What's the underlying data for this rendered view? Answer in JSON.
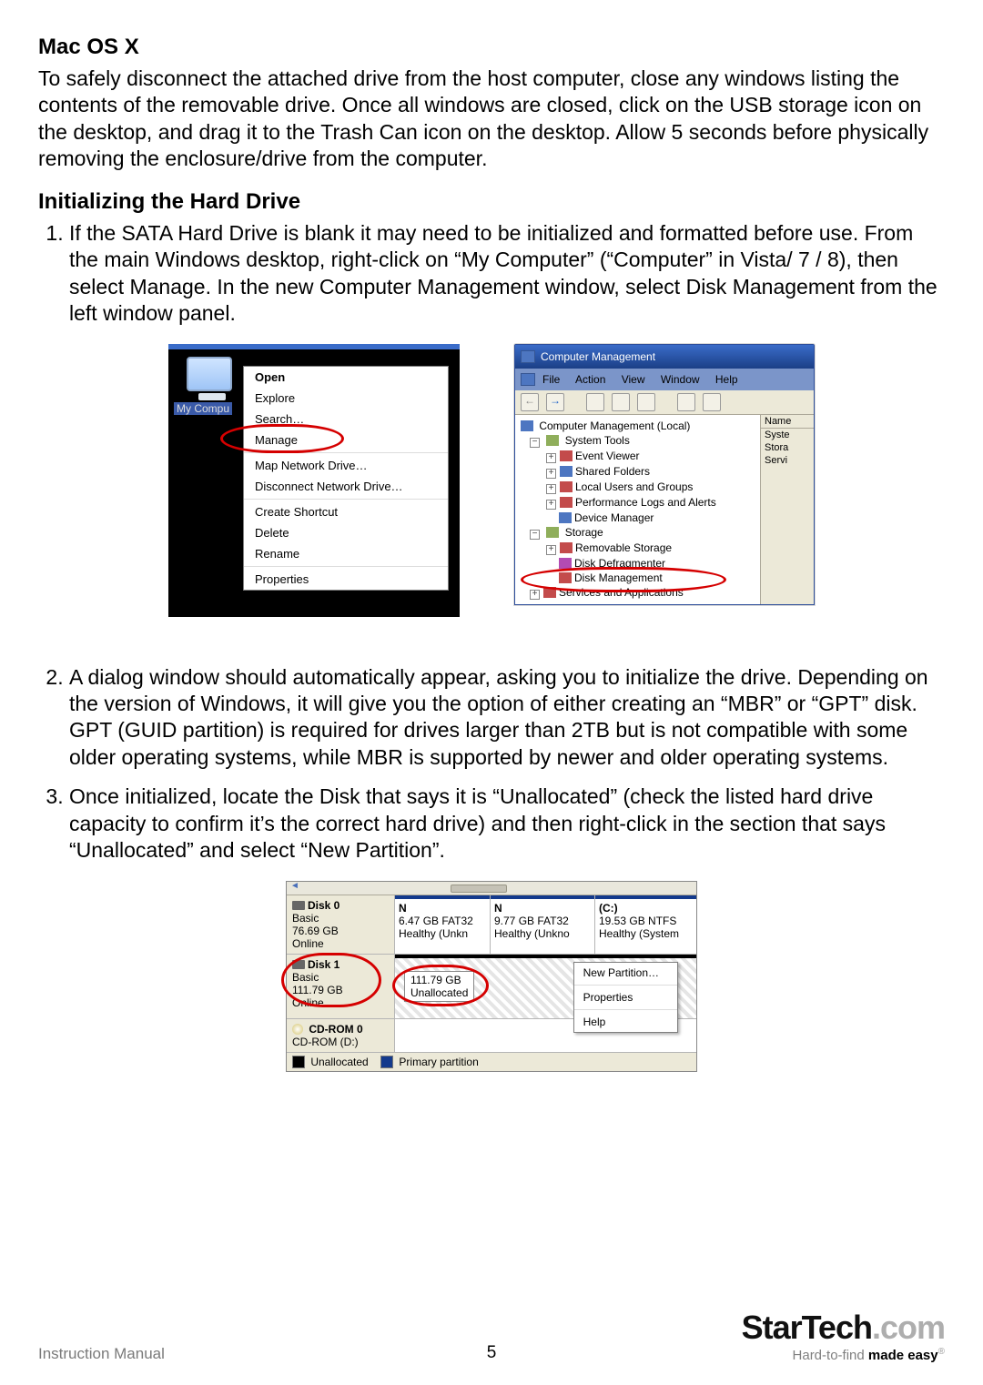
{
  "headings": {
    "macosx": "Mac OS X",
    "init": "Initializing the Hard Drive"
  },
  "mac_paragraph": "To safely disconnect the attached drive from the host computer, close any windows listing the contents of the removable drive. Once all windows are closed, click on the USB storage icon on the desktop, and drag it to the Trash Can icon on the desktop. Allow 5 seconds before physically removing the enclosure/drive from the computer.",
  "steps": {
    "s1": "If the SATA Hard Drive is blank it may need to be initialized and formatted before use. From the main Windows desktop, right-click on “My Computer” (“Computer” in Vista/ 7 / 8), then select Manage. In the new Computer Management window, select Disk Management from the left window panel.",
    "s2": "A dialog window should automatically appear, asking you to initialize the drive. Depending on the version of Windows, it will give you the option of either creating an “MBR” or “GPT” disk. GPT (GUID partition) is required for drives larger than 2TB but is not compatible with some older operating systems, while MBR is supported by newer and older operating systems.",
    "s3": "Once initialized, locate the Disk that says it is “Unallocated” (check the listed hard drive capacity to confirm it’s the correct hard drive) and then right-click in the section that says “Unallocated” and select “New Partition”."
  },
  "context_menu": {
    "icon_label": "My Compu",
    "items_1": [
      "Open",
      "Explore",
      "Search…"
    ],
    "highlight": "Manage",
    "items_2": [
      "Map Network Drive…",
      "Disconnect Network Drive…"
    ],
    "items_3": [
      "Create Shortcut",
      "Delete",
      "Rename"
    ],
    "items_4": [
      "Properties"
    ]
  },
  "cm_window": {
    "title": "Computer Management",
    "menus": [
      "File",
      "Action",
      "View",
      "Window",
      "Help"
    ],
    "tree_root": "Computer Management (Local)",
    "sys_tools": "System Tools",
    "sys_children": [
      "Event Viewer",
      "Shared Folders",
      "Local Users and Groups",
      "Performance Logs and Alerts",
      "Device Manager"
    ],
    "storage": "Storage",
    "storage_children": [
      "Removable Storage",
      "Disk Defragmenter",
      "Disk Management"
    ],
    "services": "Services and Applications",
    "namecol_hdr": "Name",
    "namecol_items": [
      "Syste",
      "Stora",
      "Servi"
    ]
  },
  "dm": {
    "disk0": {
      "title": "Disk 0",
      "type": "Basic",
      "size": "76.69 GB",
      "status": "Online"
    },
    "disk0_parts": [
      {
        "t": "N",
        "l1": "6.47 GB FAT32",
        "l2": "Healthy (Unkn"
      },
      {
        "t": "N",
        "l1": "9.77 GB FAT32",
        "l2": "Healthy (Unkno"
      },
      {
        "t": "(C:)",
        "l1": "19.53 GB NTFS",
        "l2": "Healthy (System"
      }
    ],
    "disk1": {
      "title": "Disk 1",
      "type": "Basic",
      "size": "111.79 GB",
      "status": "Online"
    },
    "disk1_unalloc_size": "111.79 GB",
    "disk1_unalloc_label": "Unallocated",
    "ctx": [
      "New Partition…",
      "Properties",
      "Help"
    ],
    "cdrom": {
      "title": "CD-ROM 0",
      "sub": "CD-ROM (D:)"
    },
    "legend": {
      "un": "Unallocated",
      "pp": "Primary partition"
    }
  },
  "footer": {
    "label": "Instruction Manual",
    "page": "5",
    "brand_a": "StarTech",
    "brand_b": ".com",
    "tag_a": "Hard-to-find ",
    "tag_b": "made easy"
  }
}
